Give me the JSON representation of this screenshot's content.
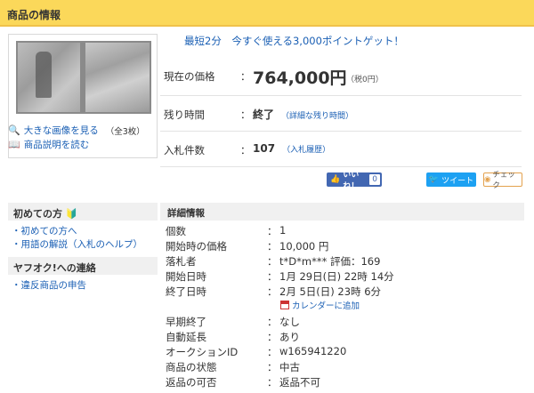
{
  "header": {
    "title": "商品の情報"
  },
  "gallery": {
    "view_large_label": "大きな画像を見る",
    "image_count": "（全3枚）",
    "description_label": "商品説明を読む"
  },
  "promo": {
    "text": "最短2分　今すぐ使える3,000ポイントゲット！"
  },
  "price": {
    "label": "現在の価格",
    "value": "764,000円",
    "tax": "（税0円）"
  },
  "remaining": {
    "label": "残り時間",
    "value": "終了",
    "link": "（詳細な残り時間）"
  },
  "bids": {
    "label": "入札件数",
    "value": "107",
    "link": "（入札履歴）"
  },
  "social": {
    "like_label": "いいね！",
    "like_count": "0",
    "tweet_label": "ツイート",
    "check_label": "チェック"
  },
  "sidebar": {
    "beginner_title": "初めての方",
    "beginner_links": [
      "・初めての方へ",
      "・用語の解説（入札のヘルプ）"
    ],
    "contact_title": "ヤフオク!への連絡",
    "contact_links": [
      "・違反商品の申告"
    ]
  },
  "details": {
    "title": "詳細情報",
    "colon": "：",
    "rows": [
      {
        "label": "個数",
        "value": "1"
      },
      {
        "label": "開始時の価格",
        "value": "10,000 円"
      },
      {
        "label": "落札者",
        "value": "t*D*m***  評価：169"
      },
      {
        "label": "開始日時",
        "value": "1月 29日(日) 22時 14分"
      },
      {
        "label": "終了日時",
        "value": "2月 5日(日) 23時 6分"
      },
      {
        "label": "早期終了",
        "value": "なし"
      },
      {
        "label": "自動延長",
        "value": "あり"
      },
      {
        "label": "オークションID",
        "value": "w165941220"
      },
      {
        "label": "商品の状態",
        "value": "中古"
      },
      {
        "label": "返品の可否",
        "value": "返品不可"
      }
    ],
    "calendar_link": "カレンダーに追加"
  },
  "icons": {
    "magnifier": "magnifier-icon",
    "book": "book-icon",
    "beginner": "beginner-leaf-icon",
    "like": "thumbs-up-icon",
    "twitter": "twitter-bird-icon",
    "check": "check-icon",
    "calendar": "calendar-icon"
  },
  "colors": {
    "header": "#fbd85a",
    "link": "#1a5fb4",
    "facebook": "#4267b2",
    "twitter": "#1da1f2"
  }
}
